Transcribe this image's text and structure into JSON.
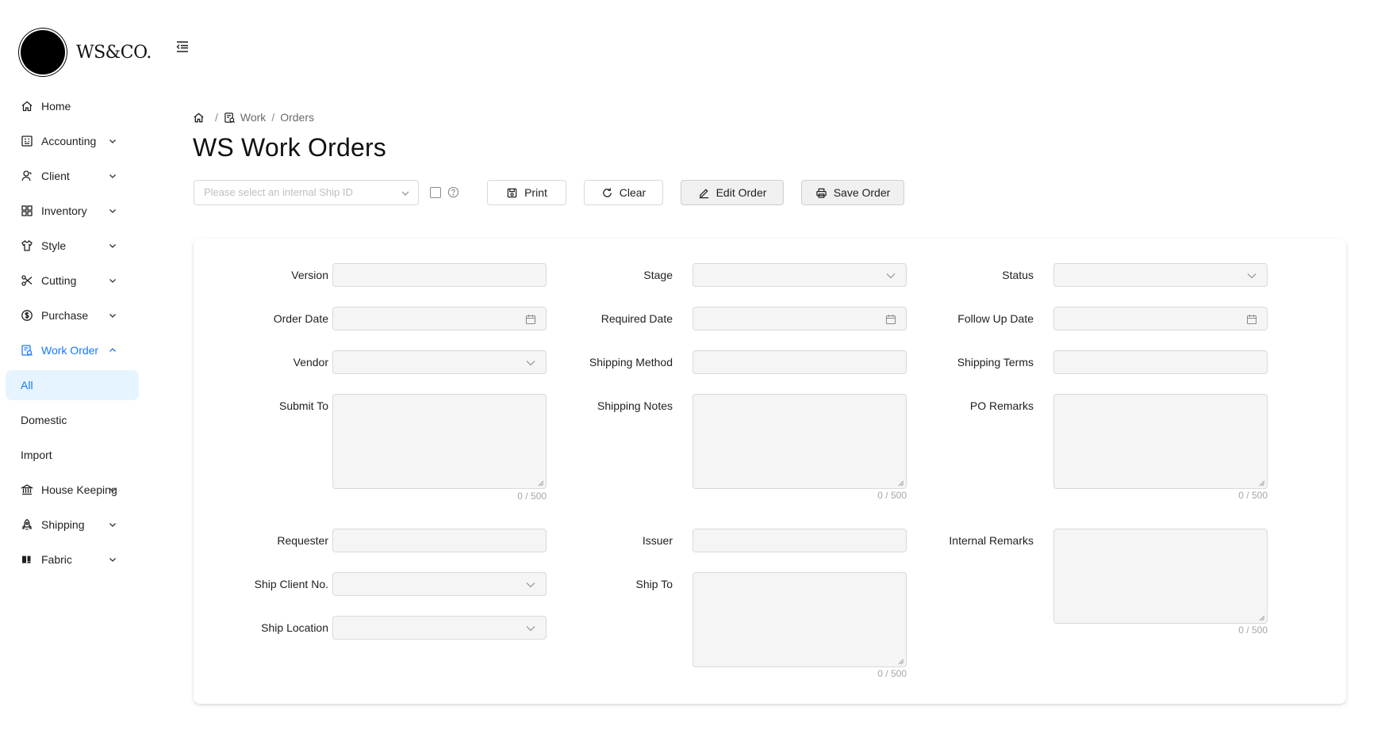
{
  "brand": {
    "name": "WS&CO."
  },
  "sidebar": {
    "items": [
      {
        "label": "Home",
        "icon": "home-icon",
        "has_children": false
      },
      {
        "label": "Accounting",
        "icon": "ledger-icon",
        "has_children": true
      },
      {
        "label": "Client",
        "icon": "user-icon",
        "has_children": true
      },
      {
        "label": "Inventory",
        "icon": "grid-icon",
        "has_children": true
      },
      {
        "label": "Style",
        "icon": "shirt-icon",
        "has_children": true
      },
      {
        "label": "Cutting",
        "icon": "scissors-icon",
        "has_children": true
      },
      {
        "label": "Purchase",
        "icon": "dollar-icon",
        "has_children": true
      },
      {
        "label": "Work Order",
        "icon": "work-order-icon",
        "has_children": true,
        "expanded": true,
        "active": true
      }
    ],
    "work_order_sub": [
      {
        "label": "All",
        "selected": true
      },
      {
        "label": "Domestic",
        "selected": false
      },
      {
        "label": "Import",
        "selected": false
      }
    ],
    "items_after": [
      {
        "label": "House Keeping",
        "icon": "bank-icon",
        "has_children": true
      },
      {
        "label": "Shipping",
        "icon": "rocket-icon",
        "has_children": true
      },
      {
        "label": "Fabric",
        "icon": "fabric-icon",
        "has_children": true
      }
    ],
    "active_color": "#1677ff",
    "selected_bg": "#e6f4ff"
  },
  "breadcrumb": {
    "sep": "/",
    "work": "Work",
    "orders": "Orders"
  },
  "page": {
    "title": "WS Work Orders"
  },
  "toolbar": {
    "ship_select_placeholder": "Please select an internal Ship ID",
    "print_label": "Print",
    "clear_label": "Clear",
    "edit_label": "Edit Order",
    "save_label": "Save Order"
  },
  "form": {
    "version": "Version",
    "stage": "Stage",
    "status": "Status",
    "order_date": "Order Date",
    "required_date": "Required Date",
    "follow_up_date": "Follow Up Date",
    "vendor": "Vendor",
    "shipping_method": "Shipping Method",
    "shipping_terms": "Shipping Terms",
    "submit_to": "Submit To",
    "shipping_notes": "Shipping Notes",
    "po_remarks": "PO Remarks",
    "requester": "Requester",
    "issuer": "Issuer",
    "internal_remarks": "Internal Remarks",
    "ship_client_no": "Ship Client No.",
    "ship_to": "Ship To",
    "ship_location": "Ship Location",
    "counter": "0 / 500"
  }
}
